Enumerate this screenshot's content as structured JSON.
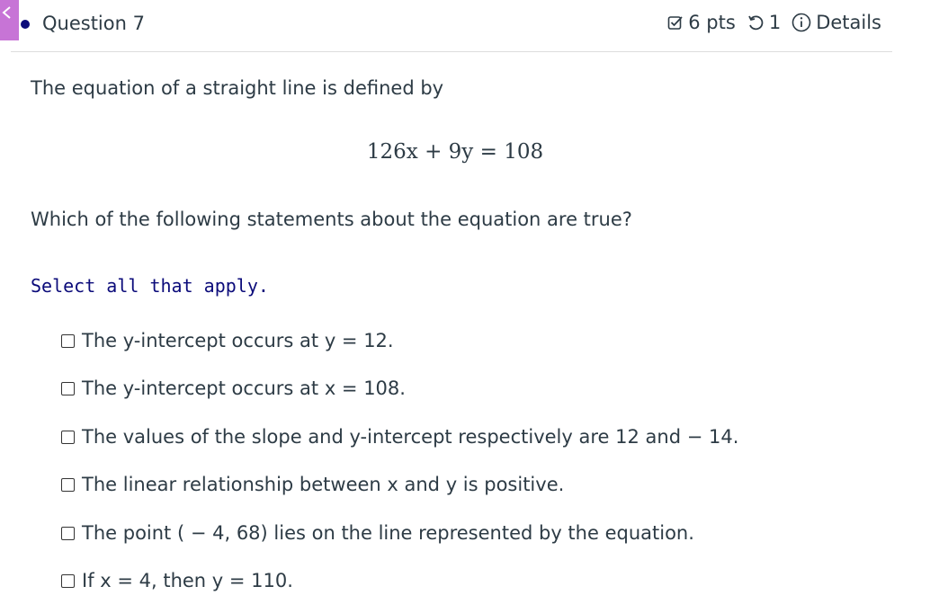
{
  "header": {
    "question_title": "Question 7",
    "points": "6 pts",
    "attempts": "1",
    "details_label": "Details"
  },
  "stem": "The equation of a straight line is defined by",
  "equation": "126x + 9y = 108",
  "question": "Which of the following statements about the equation are true?",
  "instruction": "Select all that apply.",
  "options": [
    {
      "text": "The y-intercept occurs at y = 12."
    },
    {
      "text": "The y-intercept occurs at x = 108."
    },
    {
      "text": "The values of the slope and y-intercept respectively are 12 and − 14."
    },
    {
      "text": "The linear relationship between x and y is positive."
    },
    {
      "text": "The point ( − 4, 68) lies on the line represented by the equation."
    },
    {
      "text": "If x = 4, then y = 110."
    }
  ],
  "colors": {
    "accent_tab": "#c774d6",
    "instruction_text": "#0b0b7a",
    "body_text": "#2d3b45"
  }
}
